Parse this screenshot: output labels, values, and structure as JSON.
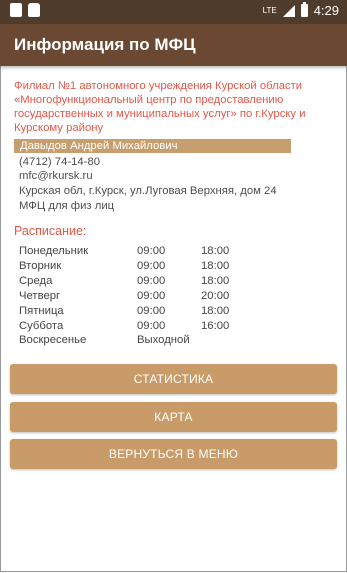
{
  "status_bar": {
    "time": "4:29",
    "network": "LTE",
    "icons": [
      "notification-icon",
      "android-icon",
      "signal-icon",
      "battery-icon"
    ]
  },
  "app_bar": {
    "title": "Информация по МФЦ"
  },
  "office": {
    "name": "Филиал №1 автономного учреждения Курской области «Многофункциональный центр по предоставлению государственных и муниципальных услуг» по г.Курску и Курскому району",
    "head": "Давыдов Андрей Михайлович",
    "phone": "(4712) 74-14-80",
    "email": "mfc@rkursk.ru",
    "address": "Курская обл,  г.Курск, ул.Луговая Верхняя, дом 24",
    "type": "МФЦ для физ лиц"
  },
  "schedule": {
    "title": "Расписание:",
    "rows": [
      {
        "day": "Понедельник",
        "open": "09:00",
        "close": "18:00"
      },
      {
        "day": "Вторник",
        "open": "09:00",
        "close": "18:00"
      },
      {
        "day": "Среда",
        "open": "09:00",
        "close": "18:00"
      },
      {
        "day": "Четверг",
        "open": "09:00",
        "close": "20:00"
      },
      {
        "day": "Пятница",
        "open": "09:00",
        "close": "18:00"
      },
      {
        "day": "Суббота",
        "open": "09:00",
        "close": "16:00"
      },
      {
        "day": "Воскресенье",
        "open": "Выходной",
        "close": ""
      }
    ]
  },
  "buttons": {
    "statistics": "СТАТИСТИКА",
    "map": "КАРТА",
    "back": "ВЕРНУТЬСЯ В МЕНЮ"
  },
  "colors": {
    "status_bar": "#503c2d",
    "app_bar": "#6a4832",
    "accent_text": "#e2584a",
    "button": "#c99b68",
    "highlight": "#c79e6d"
  }
}
